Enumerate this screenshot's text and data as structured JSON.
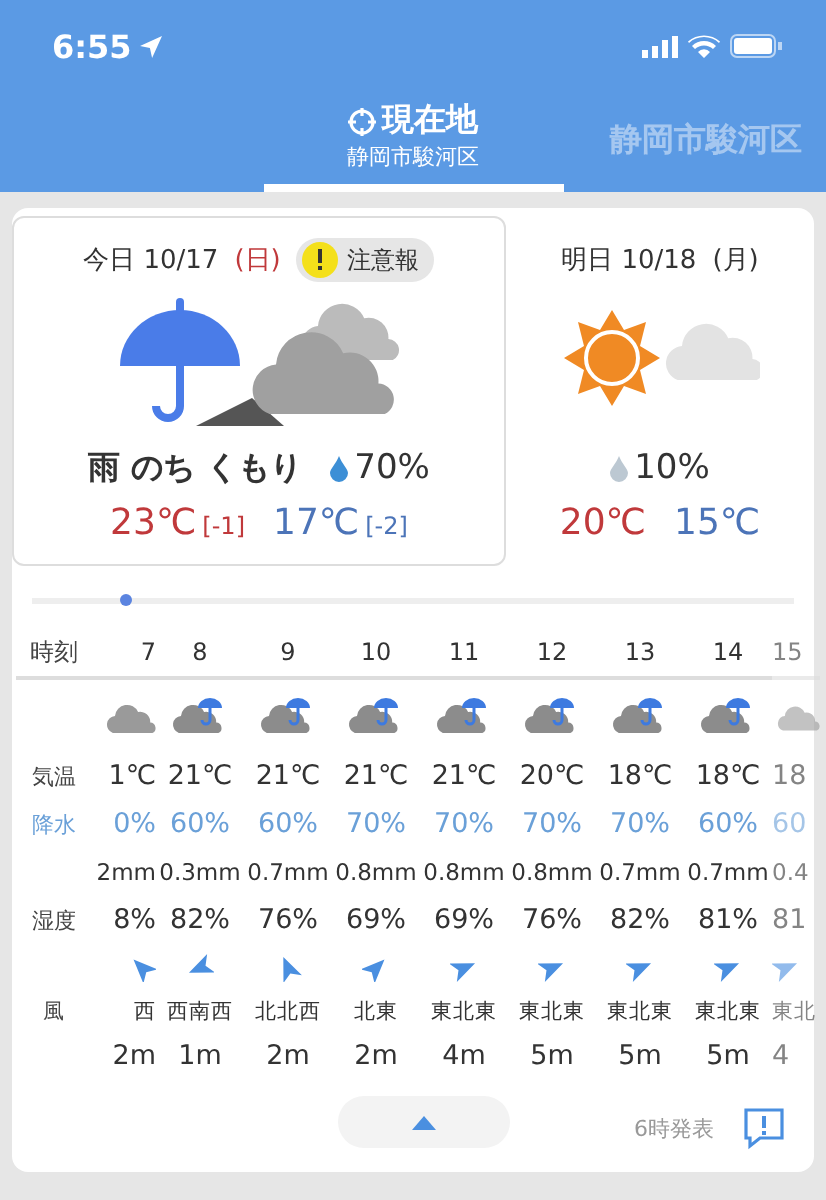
{
  "status_bar": {
    "time": "6:55"
  },
  "tabs": [
    {
      "label": "現在地",
      "sub": "静岡市駿河区",
      "selected": true
    },
    {
      "label": "静岡市駿河区",
      "selected": false
    }
  ],
  "days": [
    {
      "label": "今日 10/17",
      "weekday": "(日)",
      "sunday": true,
      "alert": "注意報",
      "kind": "rain_then_cloudy",
      "selected": true,
      "weather": "雨 のち くもり",
      "rain": "70%",
      "high": "23℃",
      "high_diff": "[-1]",
      "low": "17℃",
      "low_diff": "[-2]"
    },
    {
      "label": "明日 10/18",
      "weekday": "(月)",
      "sunday": false,
      "kind": "sunny_then_cloudy",
      "selected": false,
      "rain": "10%",
      "high": "20℃",
      "low": "15℃"
    }
  ],
  "hourly": {
    "labels": {
      "time": "時刻",
      "temp": "気温",
      "rain": "降水",
      "humidity": "湿度",
      "wind": "風"
    },
    "hours": [
      {
        "time": "7",
        "kind": "cloudy",
        "temp": "1℃",
        "rain": "0%",
        "mm": "2mm",
        "humidity": "8%",
        "wind_arrow": {
          "kind": "nw"
        },
        "dir": "西",
        "speed": "2m"
      },
      {
        "time": "8",
        "kind": "rain",
        "temp": "21℃",
        "rain": "60%",
        "mm": "0.3mm",
        "humidity": "82%",
        "wind_arrow": {
          "kind": "wsw"
        },
        "dir": "西南西",
        "speed": "1m"
      },
      {
        "time": "9",
        "kind": "rain",
        "temp": "21℃",
        "rain": "60%",
        "mm": "0.7mm",
        "humidity": "76%",
        "wind_arrow": {
          "kind": "nnw"
        },
        "dir": "北北西",
        "speed": "2m"
      },
      {
        "time": "10",
        "kind": "rain",
        "temp": "21℃",
        "rain": "70%",
        "mm": "0.8mm",
        "humidity": "69%",
        "wind_arrow": {
          "kind": "ne"
        },
        "dir": "北東",
        "speed": "2m"
      },
      {
        "time": "11",
        "kind": "rain",
        "temp": "21℃",
        "rain": "70%",
        "mm": "0.8mm",
        "humidity": "69%",
        "wind_arrow": {
          "kind": "ene"
        },
        "dir": "東北東",
        "speed": "4m"
      },
      {
        "time": "12",
        "kind": "rain",
        "temp": "20℃",
        "rain": "70%",
        "mm": "0.8mm",
        "humidity": "76%",
        "wind_arrow": {
          "kind": "ene"
        },
        "dir": "東北東",
        "speed": "5m"
      },
      {
        "time": "13",
        "kind": "rain",
        "temp": "18℃",
        "rain": "70%",
        "mm": "0.7mm",
        "humidity": "82%",
        "wind_arrow": {
          "kind": "ene"
        },
        "dir": "東北東",
        "speed": "5m"
      },
      {
        "time": "14",
        "kind": "rain",
        "temp": "18℃",
        "rain": "60%",
        "mm": "0.7mm",
        "humidity": "81%",
        "wind_arrow": {
          "kind": "ene"
        },
        "dir": "東北東",
        "speed": "5m"
      },
      {
        "time": "15",
        "kind": "cloudy",
        "temp": "18",
        "rain": "60",
        "mm": "0.4",
        "humidity": "81",
        "wind_arrow": {
          "kind": "ene"
        },
        "dir": "東北",
        "speed": "4"
      }
    ]
  },
  "footer": {
    "issued": "6時発表"
  }
}
